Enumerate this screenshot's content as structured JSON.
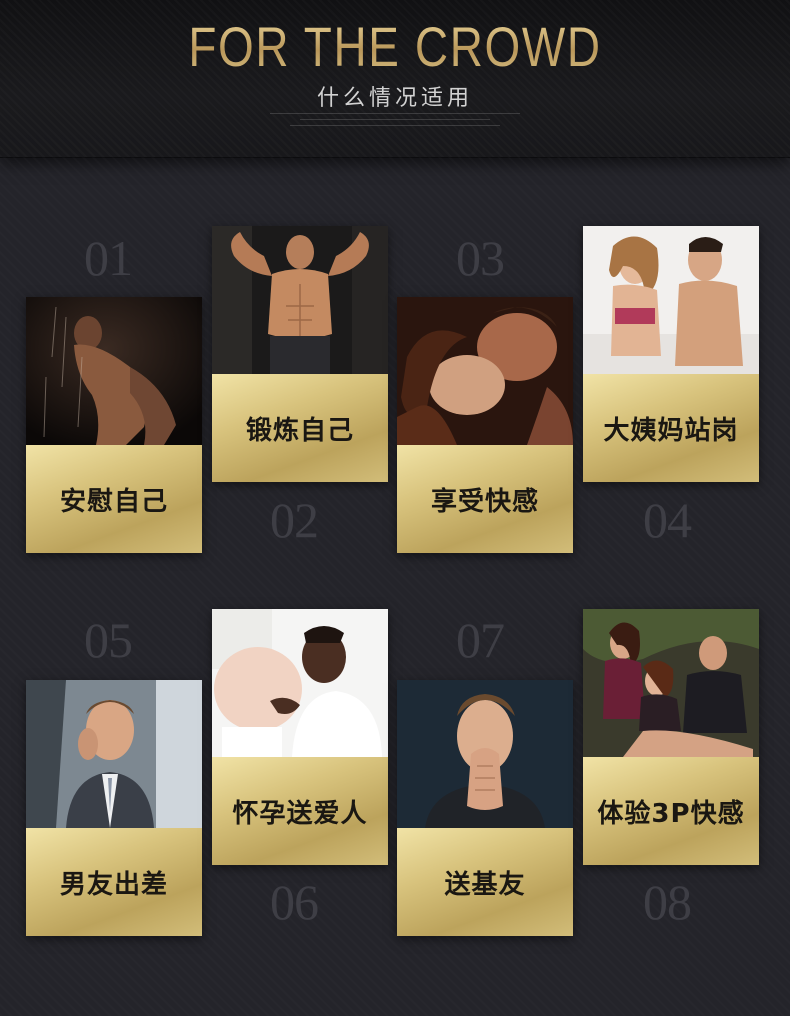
{
  "header": {
    "title_en": "FOR THE CROWD",
    "title_cn": "什么情况适用"
  },
  "cards": [
    {
      "number": "01",
      "label": "安慰自己",
      "photo": "man-in-shower"
    },
    {
      "number": "02",
      "label": "锻炼自己",
      "photo": "muscular-man-flexing"
    },
    {
      "number": "03",
      "label": "享受快感",
      "photo": "couple-kissing"
    },
    {
      "number": "04",
      "label": "大姨妈站岗",
      "photo": "couple-in-bed-back-to-back"
    },
    {
      "number": "05",
      "label": "男友出差",
      "photo": "businessman-on-phone-in-car"
    },
    {
      "number": "06",
      "label": "怀孕送爱人",
      "photo": "man-kissing-pregnant-belly"
    },
    {
      "number": "07",
      "label": "送基友",
      "photo": "man-with-hands-clasped"
    },
    {
      "number": "08",
      "label": "体验3P快感",
      "photo": "group-of-three-people"
    }
  ],
  "colors": {
    "background": "#24242a",
    "gold_light": "#f1e3a6",
    "gold_dark": "#bca35c",
    "number_gray": "#3e3e45",
    "header_gold_text": "#c6a962"
  }
}
